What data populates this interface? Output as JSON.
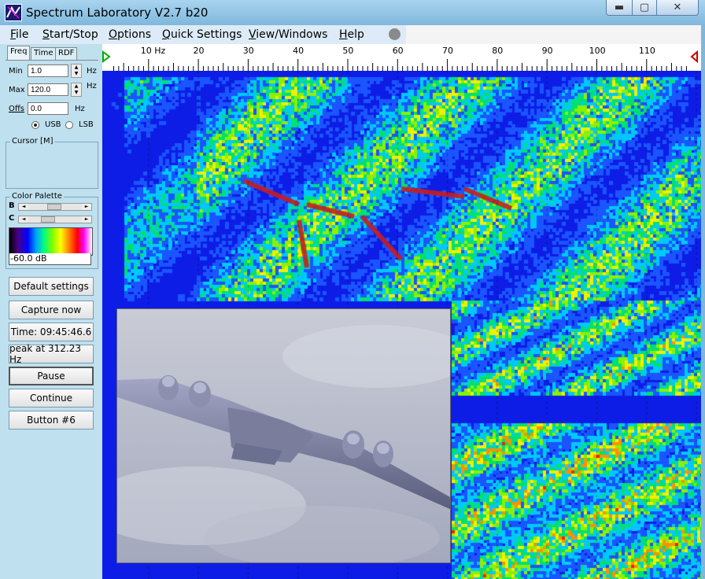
{
  "window": {
    "title": "Spectrum Laboratory V2.7 b20",
    "controls": {
      "minimize": "▬",
      "maximize": "▢",
      "close": "✕"
    }
  },
  "menu": {
    "items": [
      {
        "label": "File",
        "accel": "F",
        "rest": "ile"
      },
      {
        "label": "Start/Stop",
        "accel": "S",
        "rest": "tart/Stop"
      },
      {
        "label": "Options",
        "accel": "O",
        "rest": "ptions"
      },
      {
        "label": "Quick Settings",
        "accel": "Q",
        "rest": "uick Settings"
      },
      {
        "label": "View/Windows",
        "accel": "V",
        "rest": "iew/Windows"
      },
      {
        "label": "Help",
        "accel": "H",
        "rest": "elp"
      }
    ]
  },
  "panel": {
    "tabs": [
      "Freq",
      "Time",
      "RDF"
    ],
    "freq": {
      "min_label": "Min",
      "min_value": "1.0",
      "min_unit": "Hz",
      "max_label": "Max",
      "max_value": "120.0",
      "max_unit": "Hz",
      "offs_label": "Offs",
      "offs_value": "0.0",
      "offs_unit": "Hz",
      "usb_label": "USB",
      "lsb_label": "LSB",
      "mode": "USB"
    },
    "cursor": {
      "title": "Cursor  [M]"
    },
    "palette": {
      "title": "Color Palette",
      "b_label": "B",
      "c_label": "C",
      "level": "-60.0 dB"
    },
    "buttons": {
      "default_settings": "Default settings",
      "capture_now": "Capture now",
      "time": "Time:  09:45:46.6",
      "peak": "peak at 312.23 Hz",
      "pause": "Pause",
      "continue": "Continue",
      "button6": "Button #6"
    }
  },
  "ruler": {
    "labels": [
      {
        "text": "10 Hz",
        "f": 10
      },
      {
        "text": "20",
        "f": 20
      },
      {
        "text": "30",
        "f": 30
      },
      {
        "text": "40",
        "f": 40
      },
      {
        "text": "50",
        "f": 50
      },
      {
        "text": "60",
        "f": 60
      },
      {
        "text": "70",
        "f": 70
      },
      {
        "text": "80",
        "f": 80
      },
      {
        "text": "90",
        "f": 90
      },
      {
        "text": "100",
        "f": 100
      },
      {
        "text": "110",
        "f": 110
      }
    ],
    "fmin": 1.0,
    "fmax": 120.0
  },
  "colors": {
    "background_blue": "#0d1de6",
    "accent": "#7fb7dc"
  }
}
